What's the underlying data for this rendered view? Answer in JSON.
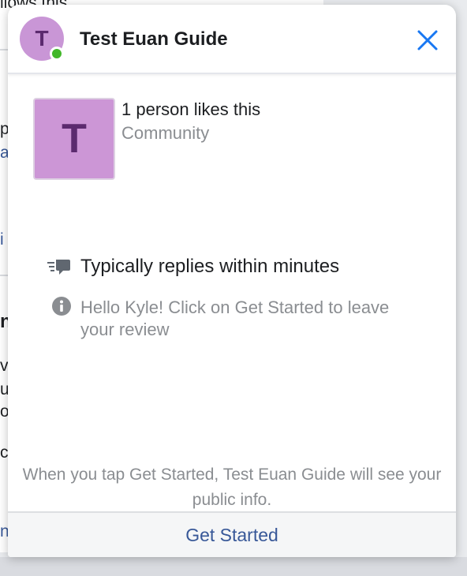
{
  "background_page": {
    "fragments": [
      "llows this",
      "p",
      "a",
      "i",
      "n",
      "vi",
      "u",
      "o",
      "c",
      "n"
    ]
  },
  "widget": {
    "header": {
      "avatar_letter": "T",
      "title": "Test Euan Guide"
    },
    "page_info": {
      "thumb_letter": "T",
      "likes": "1 person likes this",
      "category": "Community"
    },
    "response_time": "Typically replies within minutes",
    "greeting": "Hello Kyle! Click on Get Started to leave your review",
    "disclaimer": "When you tap Get Started, Test Euan Guide will see your public info.",
    "cta_label": "Get Started"
  },
  "colors": {
    "avatar_bg": "#c996d6",
    "online": "#42b72a",
    "accent": "#1877f2",
    "link": "#385898",
    "muted": "#8a8d91"
  },
  "icons": {
    "close": "close-icon",
    "reply": "chat-reply-icon",
    "info": "info-icon",
    "online": "online-status-icon"
  }
}
